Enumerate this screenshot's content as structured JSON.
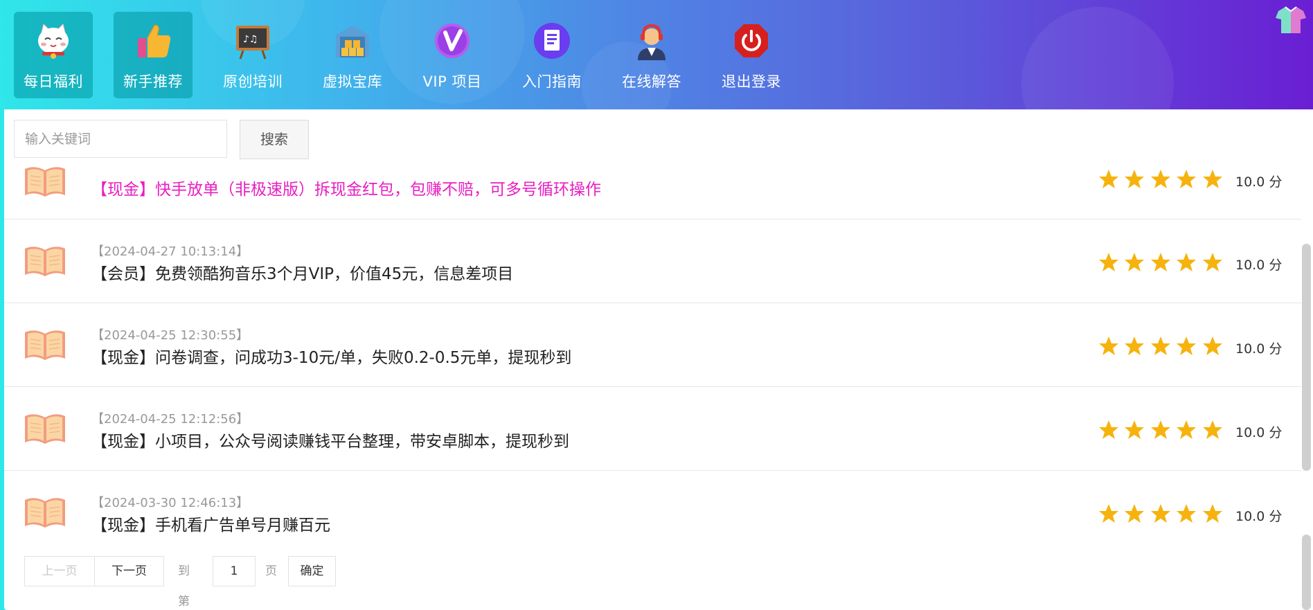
{
  "nav": {
    "items": [
      {
        "label": "每日福利",
        "icon": "lucky-cat-icon",
        "active": true
      },
      {
        "label": "新手推荐",
        "icon": "thumbs-up-icon",
        "active": true
      },
      {
        "label": "原创培训",
        "icon": "chalkboard-icon",
        "active": false
      },
      {
        "label": "虚拟宝库",
        "icon": "warehouse-icon",
        "active": false
      },
      {
        "label": "VIP 项目",
        "icon": "vip-icon",
        "active": false
      },
      {
        "label": "入门指南",
        "icon": "document-icon",
        "active": false
      },
      {
        "label": "在线解答",
        "icon": "support-agent-icon",
        "active": false
      },
      {
        "label": "退出登录",
        "icon": "power-icon",
        "active": false
      }
    ]
  },
  "search": {
    "placeholder": "输入关键词",
    "value": "",
    "button_label": "搜索"
  },
  "articles": [
    {
      "date": "",
      "title": "【现金】快手放单（非极速版）拆现金红包，包赚不赔，可多号循环操作",
      "highlight": true,
      "stars": 5,
      "score": "10.0 分"
    },
    {
      "date": "【2024-04-27 10:13:14】",
      "title": "【会员】免费领酷狗音乐3个月VIP，价值45元，信息差项目",
      "highlight": false,
      "stars": 5,
      "score": "10.0 分"
    },
    {
      "date": "【2024-04-25 12:30:55】",
      "title": "【现金】问卷调查，问成功3-10元/单，失败0.2-0.5元单，提现秒到",
      "highlight": false,
      "stars": 5,
      "score": "10.0 分"
    },
    {
      "date": "【2024-04-25 12:12:56】",
      "title": "【现金】小项目，公众号阅读赚钱平台整理，带安卓脚本，提现秒到",
      "highlight": false,
      "stars": 5,
      "score": "10.0 分"
    },
    {
      "date": "【2024-03-30 12:46:13】",
      "title": "【现金】手机看广告单号月赚百元",
      "highlight": false,
      "stars": 5,
      "score": "10.0 分"
    }
  ],
  "pager": {
    "prev_label": "上一页",
    "next_label": "下一页",
    "goto_label": "到第",
    "page_value": "1",
    "page_suffix": "页",
    "confirm_label": "确定"
  },
  "colors": {
    "header_gradient_start": "#2fe6ea",
    "header_gradient_end": "#6a1ed3",
    "highlight_title": "#e91ec2",
    "star": "#f6b30d"
  }
}
